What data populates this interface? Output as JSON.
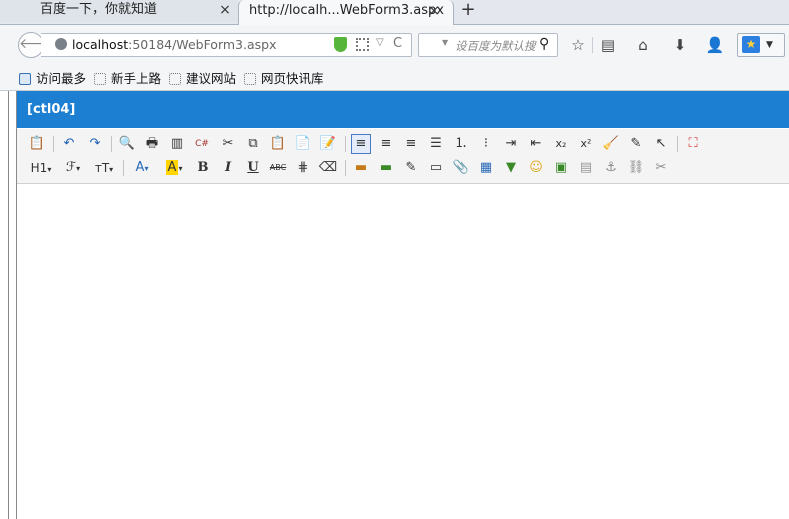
{
  "tabs": [
    {
      "label": "百度一下，你就知道",
      "close": "×"
    },
    {
      "label": "http://localh...WebForm3.aspx",
      "close": "×"
    }
  ],
  "new_tab": "+",
  "url": {
    "host": "localhost",
    "rest": ":50184/WebForm3.aspx"
  },
  "search": {
    "placeholder": "设百度为默认搜"
  },
  "bookmarks": [
    "访问最多",
    "新手上路",
    "建议网站",
    "网页快讯库"
  ],
  "editor": {
    "title": "[ctl04]"
  },
  "toolbar": {
    "heading": "H1",
    "font": "ℱ",
    "size": "тT",
    "forecolor": "A",
    "backcolor": "A",
    "bold": "B",
    "italic": "I",
    "underline": "U",
    "strike": "ABC"
  }
}
